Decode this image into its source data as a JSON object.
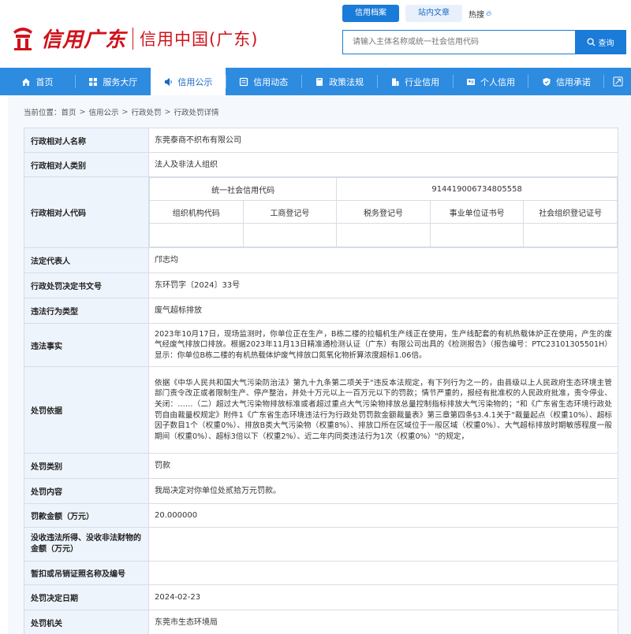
{
  "header": {
    "logo_script": "信用广东",
    "title": "信用中国(广东)",
    "tabs": [
      "信用档案",
      "站内文章"
    ],
    "hot_label": "热搜",
    "search_placeholder": "请输入主体名称或统一社会信用代码",
    "search_button": "查询"
  },
  "nav": {
    "items": [
      {
        "label": "首页",
        "icon": "home-icon"
      },
      {
        "label": "服务大厅",
        "icon": "grid-icon"
      },
      {
        "label": "信用公示",
        "icon": "announce-icon"
      },
      {
        "label": "信用动态",
        "icon": "news-icon"
      },
      {
        "label": "政策法规",
        "icon": "book-icon"
      },
      {
        "label": "行业信用",
        "icon": "building-icon"
      },
      {
        "label": "个人信用",
        "icon": "id-card-icon"
      },
      {
        "label": "信用承诺",
        "icon": "shield-icon"
      }
    ],
    "active_index": 2,
    "colors": {
      "bar": "#2d8be0",
      "active_text": "#1a68c4"
    }
  },
  "breadcrumb": {
    "prefix": "当前位置：",
    "items": [
      "首页",
      "信用公示",
      "行政处罚",
      "行政处罚详情"
    ],
    "separator": ">"
  },
  "detail": {
    "name_label": "行政相对人名称",
    "name_value": "东莞泰商不织布有限公司",
    "type_label": "行政相对人类别",
    "type_value": "法人及非法人组织",
    "code_label": "行政相对人代码",
    "credit_code_label": "统一社会信用代码",
    "credit_code_value": "91441900673480555​8",
    "sub_headers": [
      "组织机构代码",
      "工商登记号",
      "税务登记号",
      "事业单位证书号",
      "社会组织登记证号"
    ],
    "legal_rep_label": "法定代表人",
    "legal_rep_value": "邝志均",
    "doc_no_label": "行政处罚决定书文号",
    "doc_no_value": "东环罚字〔2024〕33号",
    "violation_type_label": "违法行为类型",
    "violation_type_value": "废气超标排放",
    "facts_label": "违法事实",
    "facts_value": "2023年10月17日，现场监测时，你单位正在生产，B栋二楼的拉幅机生产线正在使用，生产线配套的有机热载体炉正在使用，产生的废气经废气排放口排放。根据2023年11月13日精准通检测认证（广东）有限公司出具的《检测报告》（报告编号：PTC23101305501H）显示：你单位B栋二楼的有机热载体炉废气排放口氮氧化物折算浓度超标1.06倍。",
    "basis_label": "处罚依据",
    "basis_value": "依据《中华人民共和国大气污染防治法》第九十九条第二项关于\"违反本法规定，有下列行为之一的，由县级以上人民政府生态环境主管部门责令改正或者限制生产、停产整治，并处十万元以上一百万元以下的罚款；情节严重的，报经有批准权的人民政府批准，责令停业、关闭：……（二）超过大气污染物排放标准或者超过重点大气污染物排放总量控制指标排放大气污染物的；\"和《广东省生态环境行政处罚自由裁量权规定》附件1《广东省生态环境违法行为行政处罚罚款金额裁量表》第三章第四条§3.4.1关于\"裁量起点（权重10%）、超标因子数目1个（权重0%）、排放B类大气污染物（权重8%）、排放口所在区域位于一般区域（权重0%）、大气超标排放时期敏感程度一般期间（权重0%）、超标3倍以下（权重2%）、近二年内同类违法行为1次（权重0%）\"的规定，",
    "category_label": "处罚类别",
    "category_value": "罚款",
    "content_label": "处罚内容",
    "content_value": "我局决定对你单位处贰拾万元罚款。",
    "amount_label": "罚款金额（万元）",
    "amount_value": "20.000000",
    "confiscate_label": "没收违法所得、没收非法财物的金额（万元）",
    "confiscate_value": "",
    "license_label": "暂扣或吊销证照名称及编号",
    "license_value": "",
    "date_label": "处罚决定日期",
    "date_value": "2024-02-23",
    "org_label": "处罚机关",
    "org_value": "东莞市生态环境局"
  }
}
